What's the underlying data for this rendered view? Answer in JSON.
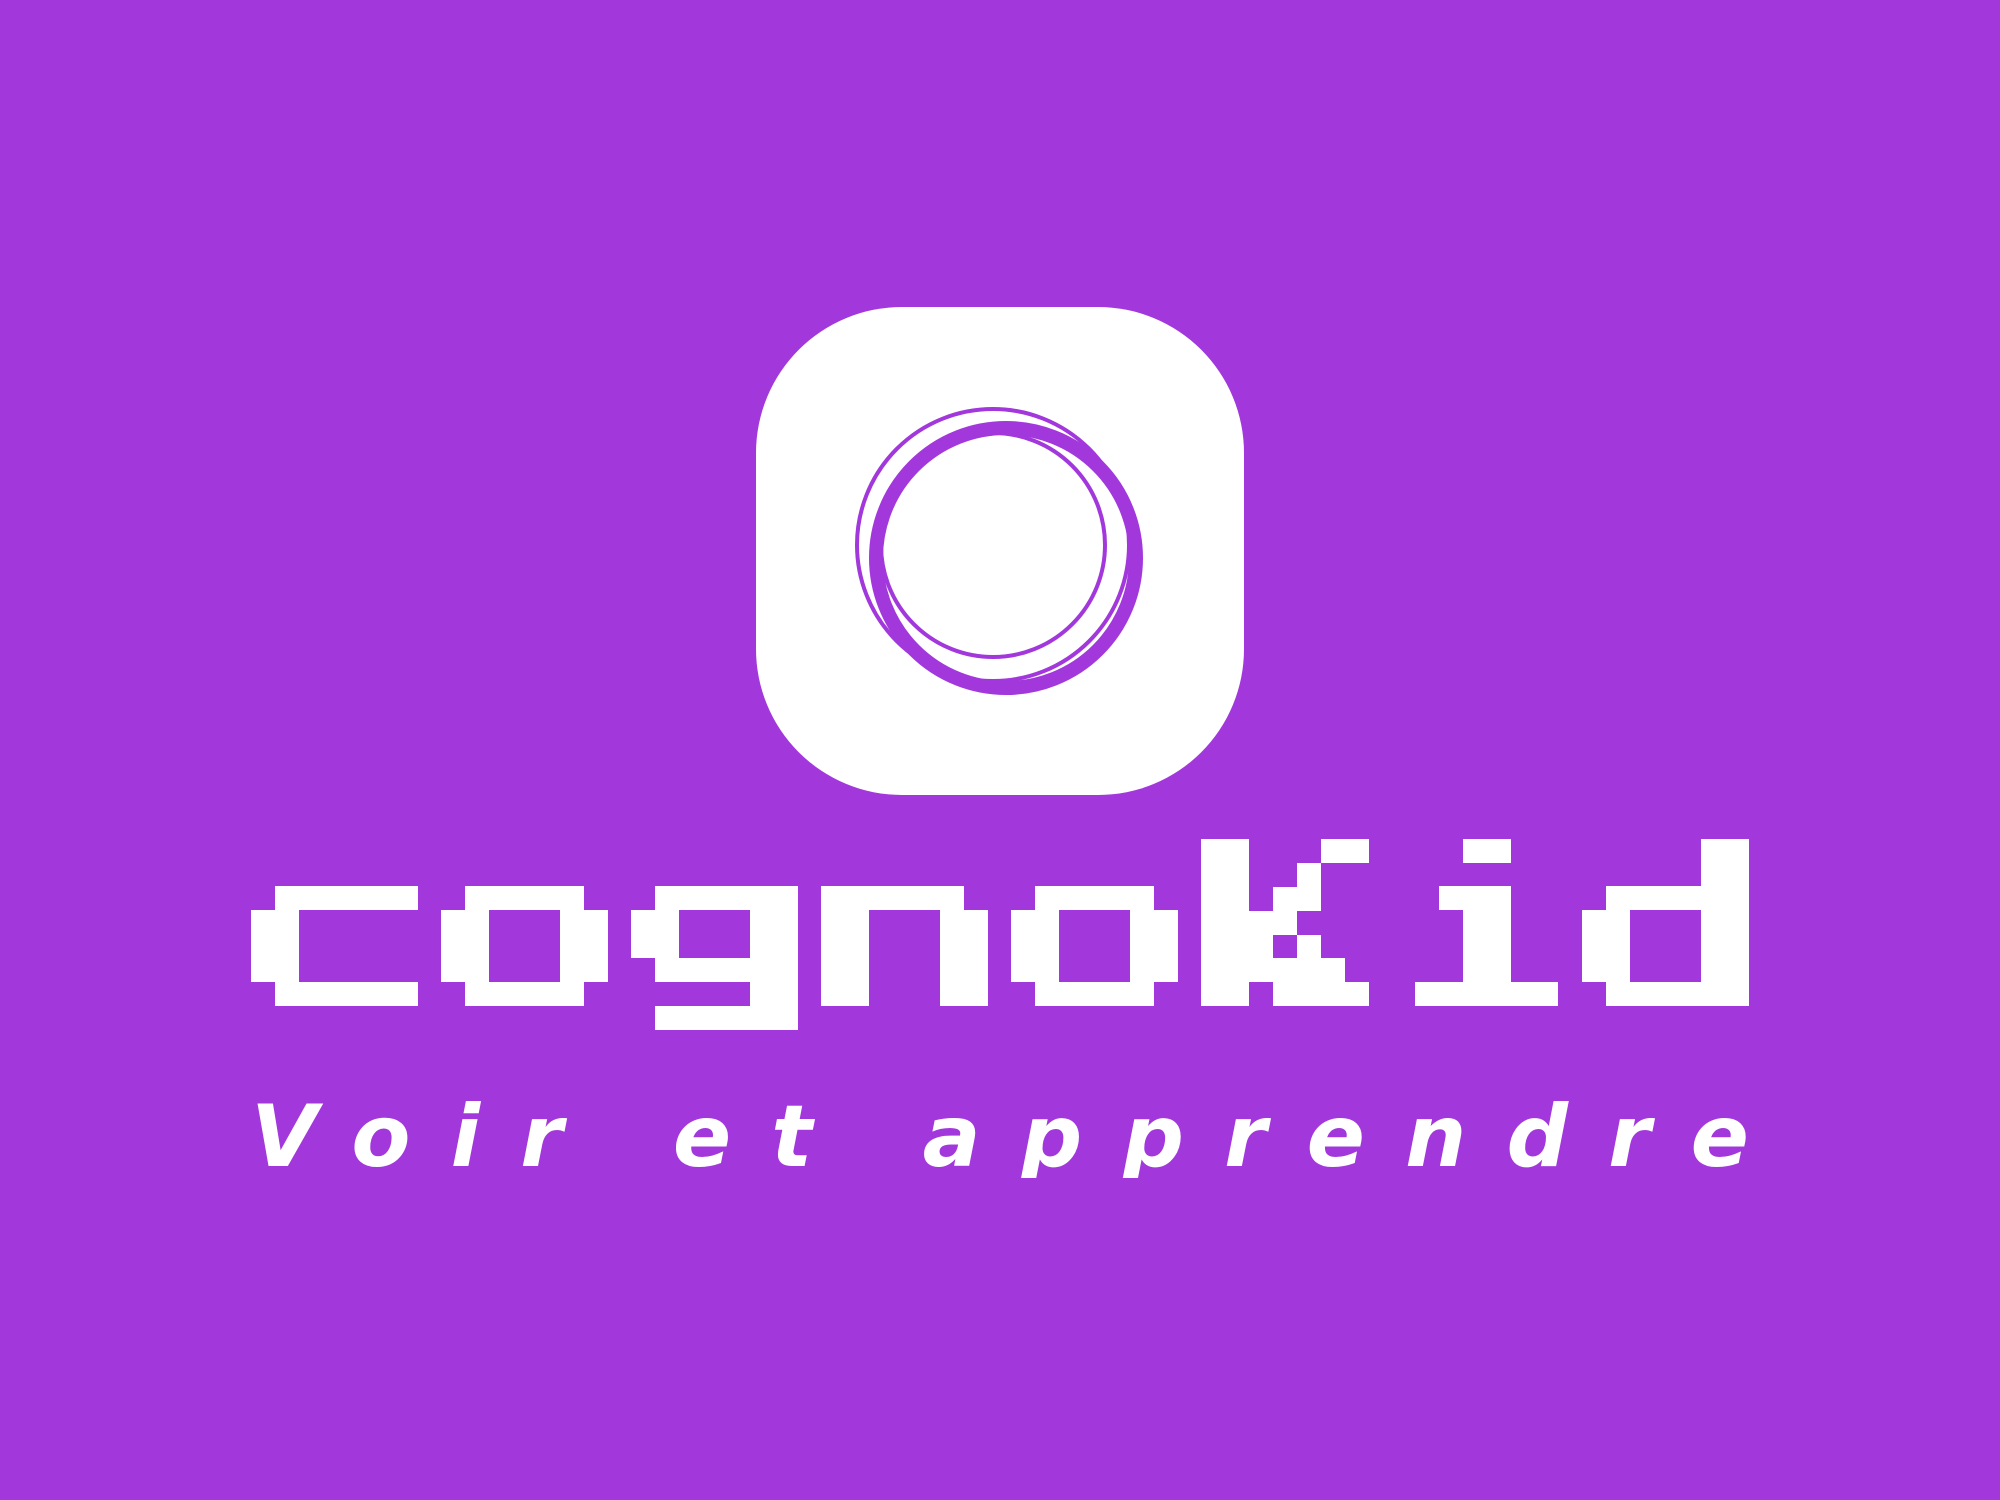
{
  "brand": {
    "name": "cognoKid",
    "tagline": "Voir et apprendre",
    "icon": "camera-lens-icon"
  },
  "colors": {
    "background": "#a238dc",
    "foreground": "#ffffff",
    "accent": "#a238dc"
  }
}
